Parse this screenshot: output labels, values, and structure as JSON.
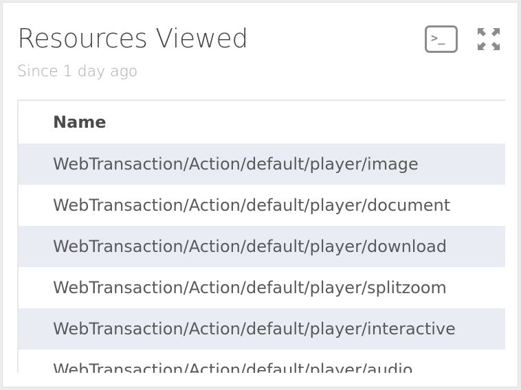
{
  "widget": {
    "title": "Resources Viewed",
    "subtitle": "Since 1 day ago",
    "terminal_icon_text": ">_"
  },
  "table": {
    "header": "Name",
    "rows": [
      "WebTransaction/Action/default/player/image",
      "WebTransaction/Action/default/player/document",
      "WebTransaction/Action/default/player/download",
      "WebTransaction/Action/default/player/splitzoom",
      "WebTransaction/Action/default/player/interactive",
      "WebTransaction/Action/default/player/audio"
    ]
  }
}
